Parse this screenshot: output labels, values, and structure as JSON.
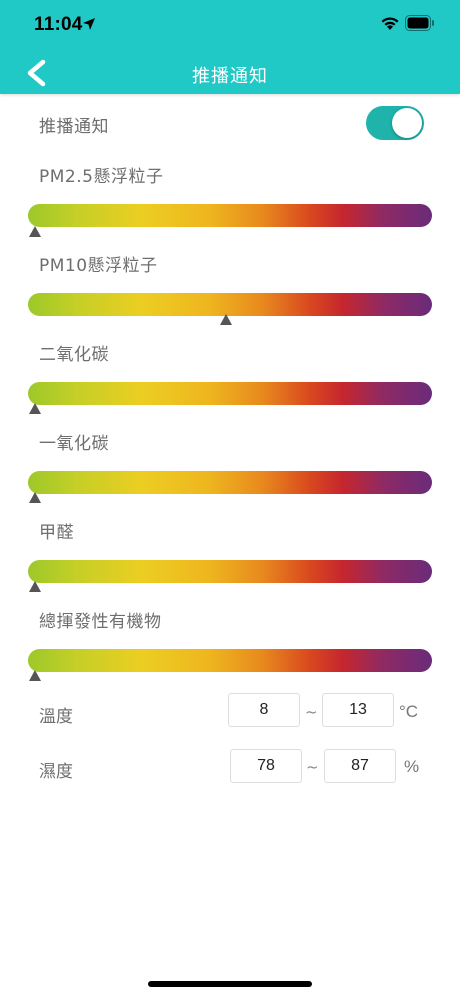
{
  "status_bar": {
    "time": "11:04"
  },
  "nav": {
    "title": "推播通知"
  },
  "push": {
    "label": "推播通知",
    "enabled": true
  },
  "sliders": [
    {
      "label": "PM2.5懸浮粒子",
      "value_fraction": 0.0
    },
    {
      "label": "PM10懸浮粒子",
      "value_fraction": 0.49
    },
    {
      "label": "二氧化碳",
      "value_fraction": 0.0
    },
    {
      "label": "一氧化碳",
      "value_fraction": 0.0
    },
    {
      "label": "甲醛",
      "value_fraction": 0.0
    },
    {
      "label": "總揮發性有機物",
      "value_fraction": 0.0
    }
  ],
  "ranges": [
    {
      "label": "溫度",
      "min": "8",
      "max": "13",
      "separator": "~",
      "unit": "°C"
    },
    {
      "label": "濕度",
      "min": "78",
      "max": "87",
      "separator": "~",
      "unit": "%"
    }
  ],
  "colors": {
    "accent": "#21c9c6",
    "toggle_on": "#1fb3ab"
  }
}
